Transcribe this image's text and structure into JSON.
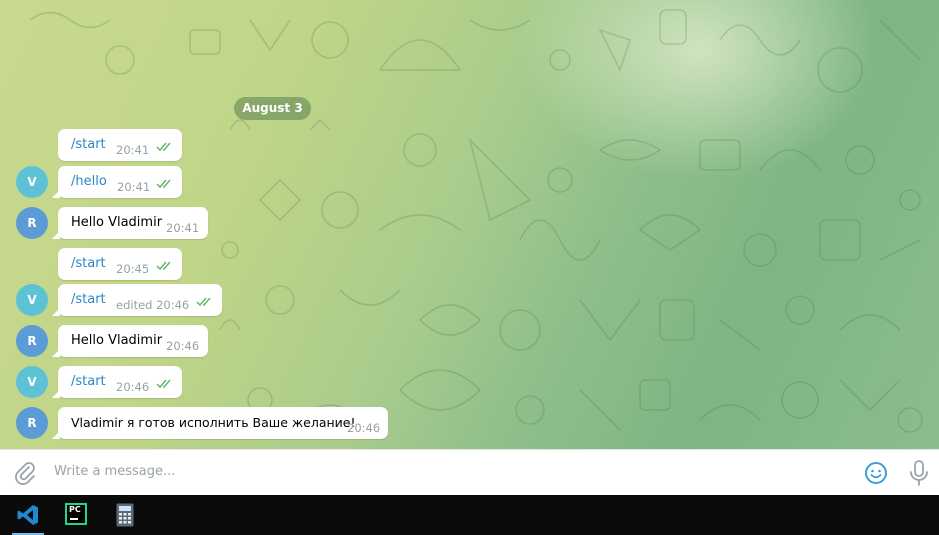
{
  "chat": {
    "date_label": "August 3",
    "messages": [
      {
        "sender": "V",
        "text": "/start",
        "time": "20:41"
      },
      {
        "sender": "V",
        "text": "/hello",
        "time": "20:41"
      },
      {
        "sender": "R",
        "text": "Hello Vladimir",
        "time": "20:41"
      },
      {
        "sender": "V",
        "text": "/start",
        "time": "20:45"
      },
      {
        "sender": "V",
        "text": "/start",
        "time": "edited 20:46"
      },
      {
        "sender": "R",
        "text": "Hello Vladimir",
        "time": "20:46"
      },
      {
        "sender": "V",
        "text": "/start",
        "time": "20:46"
      },
      {
        "sender": "R",
        "text": "Vladimir я готов исполнить Ваше желание!",
        "time": "20:46"
      }
    ],
    "avatar_v": "V",
    "avatar_r": "R"
  },
  "composer": {
    "placeholder": "Write a message...",
    "attach_icon": "paperclip-icon",
    "emoji_icon": "smiley-icon",
    "mic_icon": "microphone-icon"
  },
  "taskbar": {
    "apps": [
      "vscode-icon",
      "pycharm-icon",
      "calculator-icon"
    ],
    "pycharm_badge": "PC"
  },
  "colors": {
    "accent": "#2a87c4",
    "check": "#5fb96b",
    "avatar_v": "#5ec2d6",
    "avatar_r": "#5b9bd6"
  }
}
